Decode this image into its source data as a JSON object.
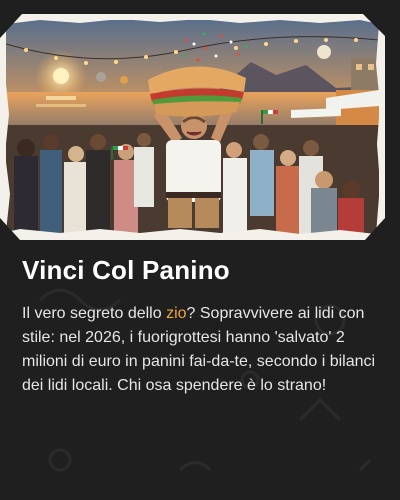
{
  "article": {
    "title": "Vinci Col Panino",
    "body": {
      "before": "Il vero segreto dello ",
      "highlight": "zio",
      "after": "? Sopravvivere ai lidi con stile: nel 2026, i fuorigrottesi hanno 'salvato' 2 milioni di euro in panini fai-da-te, secondo i bilanci dei lidi locali. Chi osa spendere è lo strano!"
    }
  },
  "colors": {
    "background": "#1f1f1f",
    "title": "#ffffff",
    "body": "#e6e6e6",
    "highlight": "#f0a53a"
  }
}
